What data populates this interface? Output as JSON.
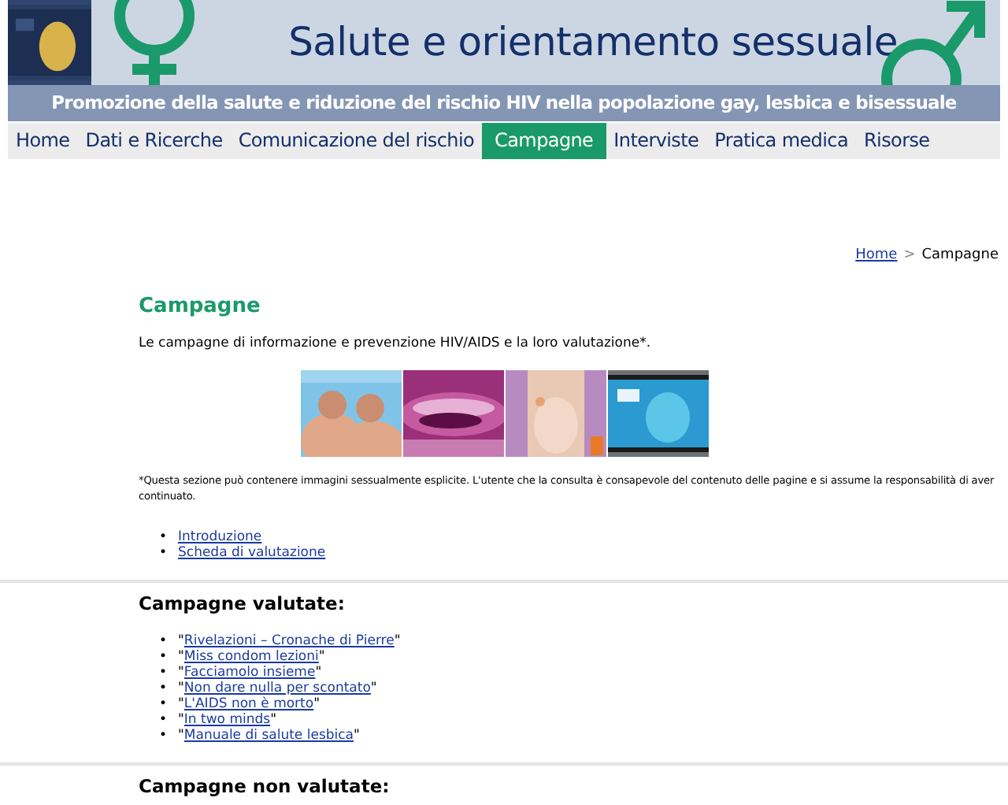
{
  "header": {
    "title": "Salute e orientamento sessuale",
    "subtitle": "Promozione della salute e riduzione del rischio HIV nella popolazione gay, lesbica e bisessuale"
  },
  "nav": [
    {
      "label": "Home",
      "selected": false
    },
    {
      "label": "Dati e Ricerche",
      "selected": false
    },
    {
      "label": "Comunicazione del rischio",
      "selected": false
    },
    {
      "label": "Campagne",
      "selected": true
    },
    {
      "label": "Interviste",
      "selected": false
    },
    {
      "label": "Pratica medica",
      "selected": false
    },
    {
      "label": "Risorse",
      "selected": false
    }
  ],
  "breadcrumb": {
    "items": [
      "Home",
      "Campagne"
    ],
    "separator": ">"
  },
  "page": {
    "heading": "Campagne",
    "intro": "Le campagne di informazione e prevenzione HIV/AIDS e la loro valutazione*.",
    "note": "*Questa sezione può contenere immagini sessualmente esplicite. L'utente che la consulta è consapevole del contenuto delle pagine e si assume la responsabilità di aver continuato.",
    "bullet": "•",
    "links": [
      "Introduzione",
      "Scheda di valutazione"
    ]
  },
  "sections": [
    {
      "heading": "Campagne valutate:",
      "quote": "\"",
      "items": [
        "Rivelazioni – Cronache di Pierre",
        "Miss condom lezioni",
        "Facciamolo insieme",
        "Non dare nulla per scontato",
        "L'AIDS non è morto",
        "In two minds",
        "Manuale di salute lesbica"
      ]
    },
    {
      "heading": "Campagne non valutate:"
    }
  ]
}
